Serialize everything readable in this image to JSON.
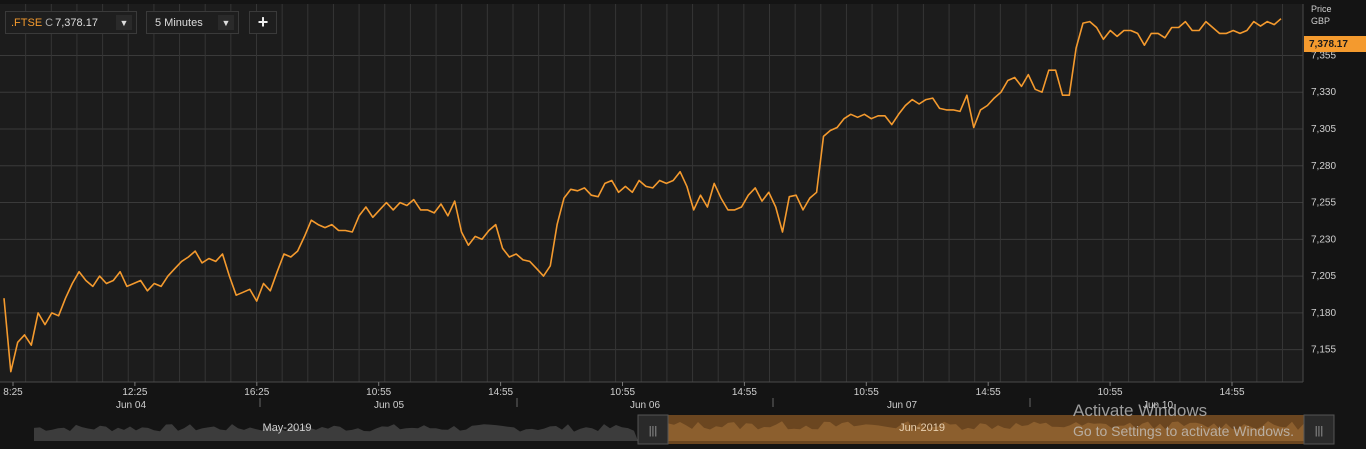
{
  "toolbar": {
    "symbol": ".FTSE",
    "close_marker": "C",
    "last_value": "7,378.17",
    "dropdown_glyph": "▼",
    "interval": "5 Minutes",
    "add_glyph": "+"
  },
  "axis_header": {
    "price": "Price",
    "currency": "GBP"
  },
  "last_price_badge": "7,378.17",
  "navigator": {
    "left_month": "May-2019",
    "right_month": "Jun-2019"
  },
  "watermark": {
    "title": "Activate Windows",
    "subtitle": "Go to Settings to activate Windows."
  },
  "colors": {
    "line": "#f49a2e",
    "background": "#1c1c1c",
    "grid": "#3a3a3a",
    "badge": "#f49a2e",
    "navigator_selected": "#7a4f22"
  },
  "chart_data": {
    "type": "line",
    "series": [
      {
        "values": [
          7190,
          7140,
          7160,
          7165,
          7158,
          7180,
          7172,
          7180,
          7178,
          7190,
          7200,
          7208,
          7202,
          7198,
          7205,
          7200,
          7202,
          7208,
          7198,
          7200,
          7202,
          7195,
          7200,
          7198,
          7205,
          7210,
          7215,
          7218,
          7222,
          7214,
          7217,
          7215,
          7220,
          7205,
          7192,
          7194,
          7196,
          7188,
          7200,
          7195,
          7208,
          7220,
          7218,
          7222,
          7232,
          7243,
          7240,
          7238,
          7240,
          7236,
          7236,
          7235,
          7246,
          7252,
          7245,
          7250,
          7255,
          7250,
          7255,
          7253,
          7257,
          7250,
          7250,
          7248,
          7254,
          7246,
          7256,
          7235,
          7226,
          7232,
          7230,
          7236,
          7240,
          7224,
          7218,
          7220,
          7216,
          7215,
          7210,
          7205,
          7212,
          7240,
          7258,
          7264,
          7263,
          7265,
          7260,
          7259,
          7268,
          7270,
          7262,
          7266,
          7262,
          7270,
          7266,
          7265,
          7270,
          7268,
          7270,
          7276,
          7266,
          7250,
          7260,
          7252,
          7268,
          7258,
          7250,
          7250,
          7252,
          7260,
          7265,
          7256,
          7262,
          7252,
          7235,
          7259,
          7260,
          7250,
          7258,
          7262,
          7300,
          7304,
          7306,
          7312,
          7315,
          7313,
          7315,
          7312,
          7314,
          7314,
          7308,
          7315,
          7321,
          7325,
          7322,
          7325,
          7326,
          7319,
          7318,
          7318,
          7317,
          7328,
          7306,
          7318,
          7321,
          7326,
          7330,
          7338,
          7340,
          7334,
          7342,
          7332,
          7330,
          7345,
          7345,
          7328,
          7328,
          7360,
          7377,
          7378,
          7374,
          7366,
          7372,
          7368,
          7372,
          7372,
          7370,
          7362,
          7370,
          7370,
          7367,
          7374,
          7374,
          7378,
          7372,
          7372,
          7378,
          7374,
          7370,
          7370,
          7372,
          7370,
          7372,
          7378,
          7375,
          7378,
          7376,
          7380
        ]
      }
    ],
    "y_ticks": [
      "7,155",
      "7,180",
      "7,205",
      "7,230",
      "7,255",
      "7,280",
      "7,305",
      "7,330",
      "7,355"
    ],
    "y_tick_values": [
      7155,
      7180,
      7205,
      7230,
      7255,
      7280,
      7305,
      7330,
      7355
    ],
    "ylim": [
      7133,
      7390
    ],
    "x_time_labels": [
      "8:25",
      "12:25",
      "16:25",
      "10:55",
      "14:55",
      "10:55",
      "14:55",
      "10:55",
      "14:55",
      "10:55",
      "14:55"
    ],
    "x_date_labels": [
      "Jun 04",
      "Jun 05",
      "Jun 06",
      "Jun 07",
      "Jun 10"
    ],
    "grid": true,
    "last_value": 7378.17
  }
}
